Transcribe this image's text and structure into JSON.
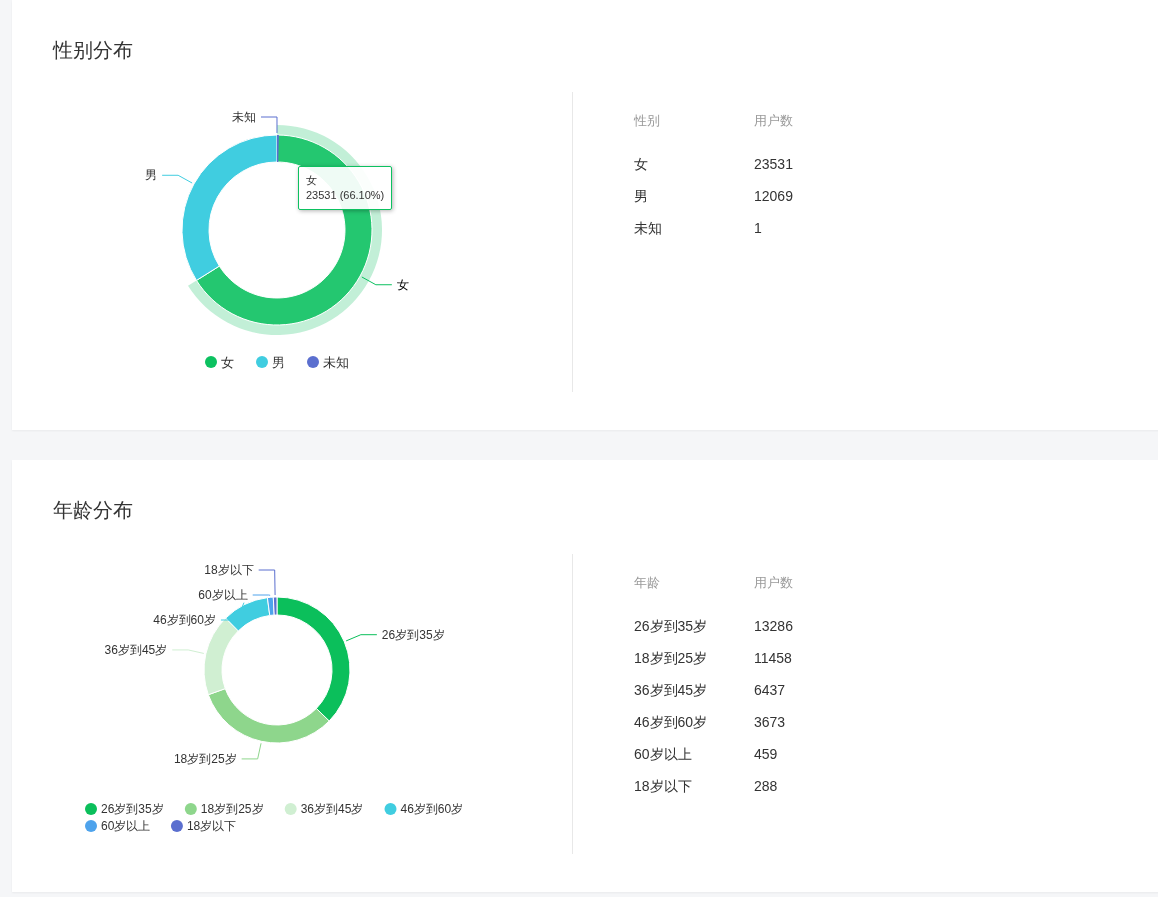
{
  "cards": [
    {
      "title": "性别分布",
      "chart_data": {
        "type": "donut",
        "categories": [
          "女",
          "男",
          "未知"
        ],
        "values": [
          66.097,
          33.9,
          0.003
        ]
      },
      "legend": [
        {
          "label": "女",
          "color": "#0cc160",
          "hovered": true
        },
        {
          "label": "男",
          "color": "#40cde0",
          "hovered": false
        },
        {
          "label": "未知",
          "color": "#5b6fcf",
          "hovered": false
        }
      ],
      "tooltip": {
        "title": "女",
        "text": "23531 (66.10%)"
      },
      "table": {
        "columns": [
          "性别",
          "用户数"
        ],
        "rows": [
          [
            "女",
            "23531"
          ],
          [
            "男",
            "12069"
          ],
          [
            "未知",
            "1"
          ]
        ]
      }
    },
    {
      "title": "年龄分布",
      "chart_data": {
        "type": "donut",
        "categories": [
          "26岁到35岁",
          "18岁到25岁",
          "36岁到45岁",
          "46岁到60岁",
          "60岁以上",
          "18岁以下"
        ],
        "values": [
          37.32,
          32.18,
          18.08,
          10.32,
          1.29,
          0.81
        ]
      },
      "legend": [
        {
          "label": "26岁到35岁",
          "color": "#0bbf5b",
          "hovered": false
        },
        {
          "label": "18岁到25岁",
          "color": "#8ed68c",
          "hovered": false
        },
        {
          "label": "36岁到45岁",
          "color": "#d0efd2",
          "hovered": false
        },
        {
          "label": "46岁到60岁",
          "color": "#40cde0",
          "hovered": false
        },
        {
          "label": "60岁以上",
          "color": "#4ea3ec",
          "hovered": false
        },
        {
          "label": "18岁以下",
          "color": "#5b6fcf",
          "hovered": false
        }
      ],
      "table": {
        "columns": [
          "年龄",
          "用户数"
        ],
        "rows": [
          [
            "26岁到35岁",
            "13286"
          ],
          [
            "18岁到25岁",
            "11458"
          ],
          [
            "36岁到45岁",
            "6437"
          ],
          [
            "46岁到60岁",
            "3673"
          ],
          [
            "60岁以上",
            "459"
          ],
          [
            "18岁以下",
            "288"
          ]
        ]
      }
    }
  ]
}
